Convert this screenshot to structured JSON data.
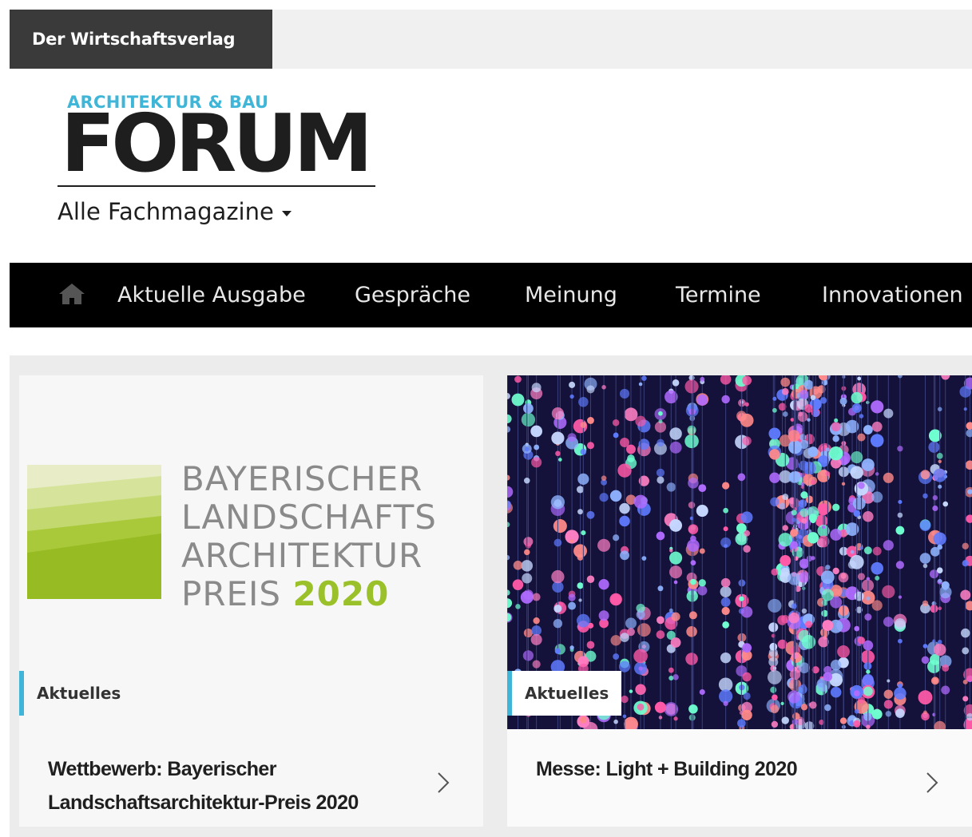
{
  "topbar": {
    "publisher": "Der Wirtschaftsverlag"
  },
  "header": {
    "logo_sub": "ARCHITEKTUR & BAU",
    "logo_main": "FORUM",
    "magazines_label": "Alle Fachmagazine"
  },
  "nav": {
    "home_icon": "home-icon",
    "items": [
      {
        "label": "Aktuelle Ausgabe"
      },
      {
        "label": "Gespräche"
      },
      {
        "label": "Meinung"
      },
      {
        "label": "Termine"
      },
      {
        "label": "Innovationen"
      }
    ]
  },
  "colors": {
    "accent": "#3fb6d8",
    "green": "#9bc12a",
    "nav_bg": "#000000"
  },
  "cards": [
    {
      "image_lines": [
        "BAYERISCHER",
        "LANDSCHAFTS",
        "ARCHITEKTUR",
        "PREIS"
      ],
      "image_year": "2020",
      "tag": "Aktuelles",
      "title": "Wettbewerb: Bayerischer Landschaftsarchitektur-Preis 2020"
    },
    {
      "tag": "Aktuelles",
      "title": "Messe: Light + Building 2020"
    }
  ]
}
